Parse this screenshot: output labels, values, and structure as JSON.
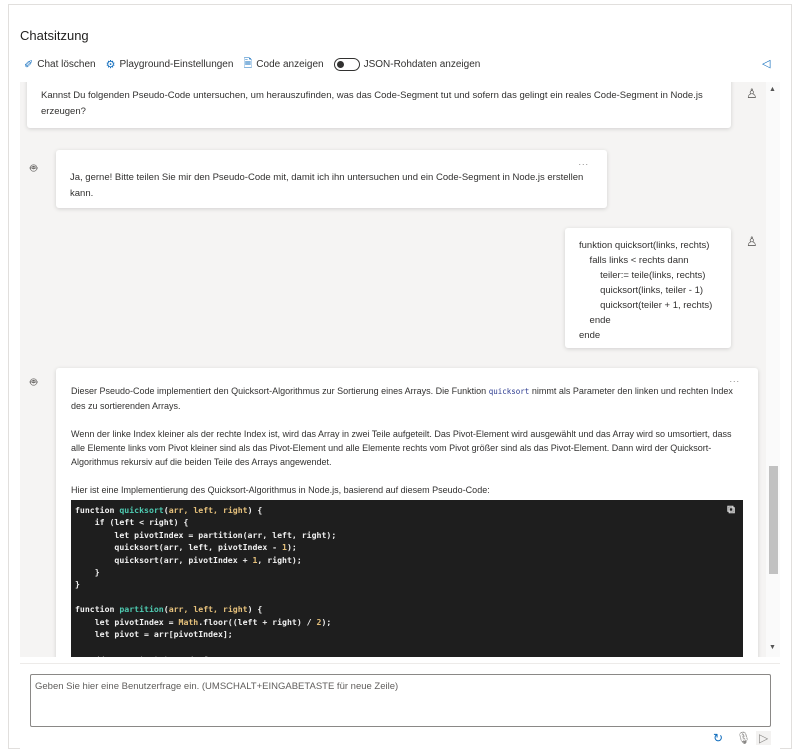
{
  "header": {
    "title": "Chatsitzung"
  },
  "toolbar": {
    "clear": "Chat löschen",
    "settings": "Playground-Einstellungen",
    "code": "Code anzeigen",
    "json": "JSON-Rohdaten anzeigen",
    "json_toggle_on": false
  },
  "messages": [
    {
      "role": "user",
      "text": "Kannst Du folgenden Pseudo-Code untersuchen, um herauszufinden, was das Code-Segment tut und sofern das gelingt ein reales Code-Segment in Node.js erzeugen?"
    },
    {
      "role": "assistant",
      "text": "Ja, gerne! Bitte teilen Sie mir den Pseudo-Code mit, damit ich ihn untersuchen und ein Code-Segment in Node.js erstellen kann.",
      "more": "..."
    },
    {
      "role": "user",
      "text": "funktion quicksort(links, rechts)\n    falls links < rechts dann\n        teiler:= teile(links, rechts)\n        quicksort(links, teiler - 1)\n        quicksort(teiler + 1, rechts)\n    ende\nende"
    },
    {
      "role": "assistant",
      "more": "...",
      "p1a": "Dieser Pseudo-Code implementiert den Quicksort-Algorithmus zur Sortierung eines Arrays. Die Funktion ",
      "p1code": "quicksort",
      "p1b": " nimmt als Parameter den linken und rechten Index des zu sortierenden Arrays.",
      "p2": "Wenn der linke Index kleiner als der rechte Index ist, wird das Array in zwei Teile aufgeteilt. Das Pivot-Element wird ausgewählt und das Array wird so umsortiert, dass alle Elemente links vom Pivot kleiner sind als das Pivot-Element und alle Elemente rechts vom Pivot größer sind als das Pivot-Element. Dann wird der Quicksort-Algorithmus rekursiv auf die beiden Teile des Arrays angewendet.",
      "p3": "Hier ist eine Implementierung des Quicksort-Algorithmus in Node.js, basierend auf diesem Pseudo-Code:",
      "code": [
        "function quicksort(arr, left, right) {",
        "    if (left < right) {",
        "        let pivotIndex = partition(arr, left, right);",
        "        quicksort(arr, left, pivotIndex - 1);",
        "        quicksort(arr, pivotIndex + 1, right);",
        "    }",
        "}",
        "",
        "function partition(arr, left, right) {",
        "    let pivotIndex = Math.floor((left + right) / 2);",
        "    let pivot = arr[pivotIndex];",
        "",
        "    // move pivot to end of array"
      ]
    }
  ],
  "input": {
    "placeholder": "Geben Sie hier eine Benutzerfrage ein. (UMSCHALT+EINGABETASTE für neue Zeile)",
    "value": ""
  }
}
